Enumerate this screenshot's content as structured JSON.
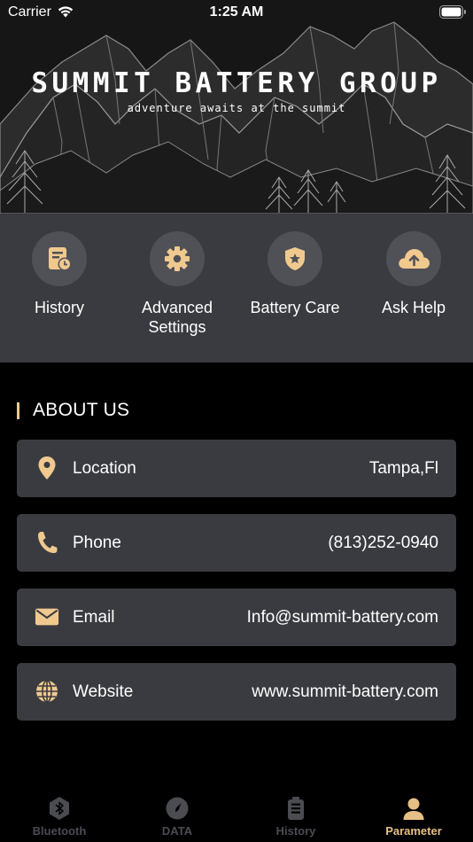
{
  "status_bar": {
    "carrier": "Carrier",
    "time": "1:25 AM"
  },
  "banner": {
    "title": "SUMMIT BATTERY GROUP",
    "tagline": "adventure awaits at the summit"
  },
  "actions": [
    {
      "label": "History",
      "icon": "history-clock-icon"
    },
    {
      "label": "Advanced\nSettings",
      "icon": "gear-icon"
    },
    {
      "label": "Battery Care",
      "icon": "shield-star-icon"
    },
    {
      "label": "Ask Help",
      "icon": "cloud-upload-icon"
    }
  ],
  "about": {
    "title": "ABOUT US",
    "rows": [
      {
        "key": "Location",
        "value": "Tampa,Fl",
        "icon": "location-pin-icon"
      },
      {
        "key": "Phone",
        "value": "(813)252-0940",
        "icon": "phone-icon"
      },
      {
        "key": "Email",
        "value": "Info@summit-battery.com",
        "icon": "mail-icon"
      },
      {
        "key": "Website",
        "value": "www.summit-battery.com",
        "icon": "globe-icon"
      }
    ]
  },
  "tabs": [
    {
      "label": "Bluetooth",
      "icon": "bluetooth-icon",
      "active": false
    },
    {
      "label": "DATA",
      "icon": "compass-icon",
      "active": false
    },
    {
      "label": "History",
      "icon": "battery-list-icon",
      "active": false
    },
    {
      "label": "Parameter",
      "icon": "user-icon",
      "active": true
    }
  ],
  "colors": {
    "accent": "#f0c98f",
    "panel": "#3a3b40",
    "background": "#000000",
    "tab_inactive": "#4b4c52"
  }
}
